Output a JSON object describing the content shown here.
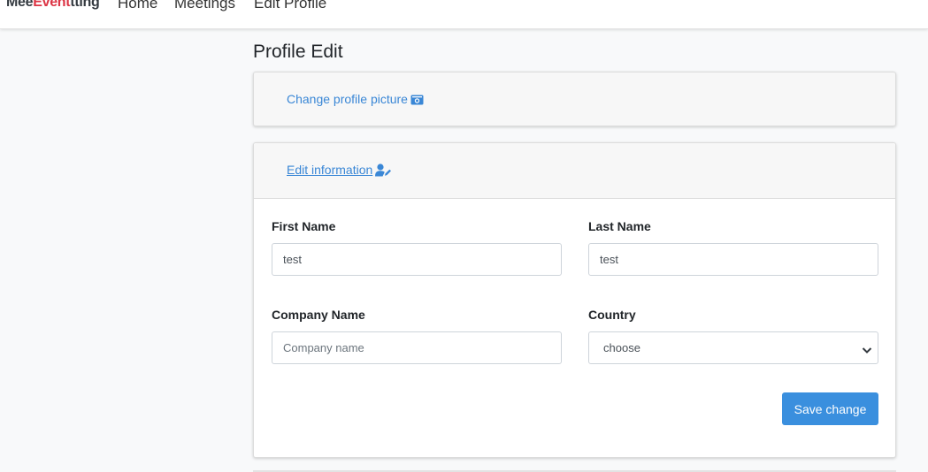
{
  "navbar": {
    "brand": {
      "part_a": "Mee",
      "part_b": "Event",
      "part_c": "tting"
    },
    "links": [
      "Home",
      "Meetings",
      "Edit Profile"
    ]
  },
  "page": {
    "title": "Profile Edit"
  },
  "picture_card": {
    "link_label": "Change profile picture",
    "icon": "camera-icon"
  },
  "edit_card": {
    "link_label": "Edit information",
    "icon": "user-edit-icon",
    "fields": {
      "first_name": {
        "label": "First Name",
        "value": "test"
      },
      "last_name": {
        "label": "Last Name",
        "value": "test"
      },
      "company_name": {
        "label": "Company Name",
        "value": "",
        "placeholder": "Company name"
      },
      "country": {
        "label": "Country",
        "selected": "choose"
      }
    },
    "save_label": "Save change"
  },
  "colors": {
    "accent": "#3a8fde",
    "brand_red": "#dc3545",
    "link": "#3a87d6"
  }
}
